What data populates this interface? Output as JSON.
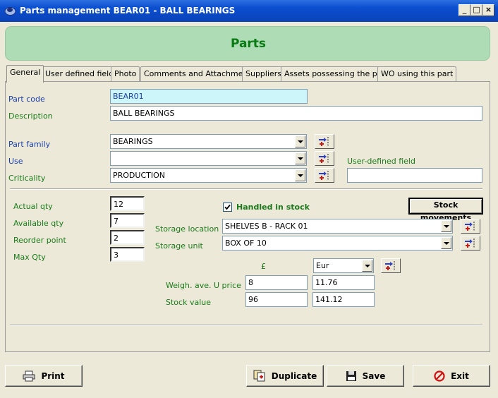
{
  "window": {
    "title": "Parts management BEAR01 - BALL BEARINGS",
    "minimize_glyph": "_",
    "maximize_glyph": "□",
    "close_glyph": "×"
  },
  "header": {
    "title": "Parts"
  },
  "tabs": [
    {
      "label": "General",
      "active": true
    },
    {
      "label": "User defined fields"
    },
    {
      "label": "Photo"
    },
    {
      "label": "Comments and Attachments"
    },
    {
      "label": "Suppliers"
    },
    {
      "label": "Assets possessing the part"
    },
    {
      "label": "WO using this part"
    }
  ],
  "general": {
    "part_code_label": "Part code",
    "part_code_value": "BEAR01",
    "description_label": "Description",
    "description_value": "BALL BEARINGS",
    "part_family_label": "Part family",
    "part_family_value": "BEARINGS",
    "use_label": "Use",
    "use_value": "",
    "criticality_label": "Criticality",
    "criticality_value": "PRODUCTION",
    "user_defined_label": "User-defined field",
    "user_defined_value": ""
  },
  "stock": {
    "actual_qty_label": "Actual qty",
    "actual_qty_value": "12",
    "available_qty_label": "Available qty",
    "available_qty_value": "7",
    "reorder_point_label": "Reorder point",
    "reorder_point_value": "2",
    "max_qty_label": "Max Qty",
    "max_qty_value": "3",
    "handled_in_stock_label": "Handled in stock",
    "handled_in_stock_checked": true,
    "stock_movements_button": "Stock movements",
    "storage_location_label": "Storage location",
    "storage_location_value": "SHELVES B - RACK 01",
    "storage_unit_label": "Storage unit",
    "storage_unit_value": "BOX OF 10",
    "currency_symbol": "£",
    "currency_select_value": "Eur",
    "weighted_price_label": "Weigh. ave. U price",
    "weighted_price_gbp": "8",
    "weighted_price_eur": "11.76",
    "stock_value_label": "Stock value",
    "stock_value_gbp": "96",
    "stock_value_eur": "141.12"
  },
  "footer": {
    "print_label": "Print",
    "duplicate_label": "Duplicate",
    "save_label": "Save",
    "exit_label": "Exit"
  },
  "colors": {
    "title_bar": "#0b4fd0",
    "header_banner": "#aedcb5",
    "header_text": "#0a7a12",
    "label_blue": "#1a3ea8",
    "label_green": "#1b7a1b",
    "part_code_bg": "#cdf6fb"
  }
}
